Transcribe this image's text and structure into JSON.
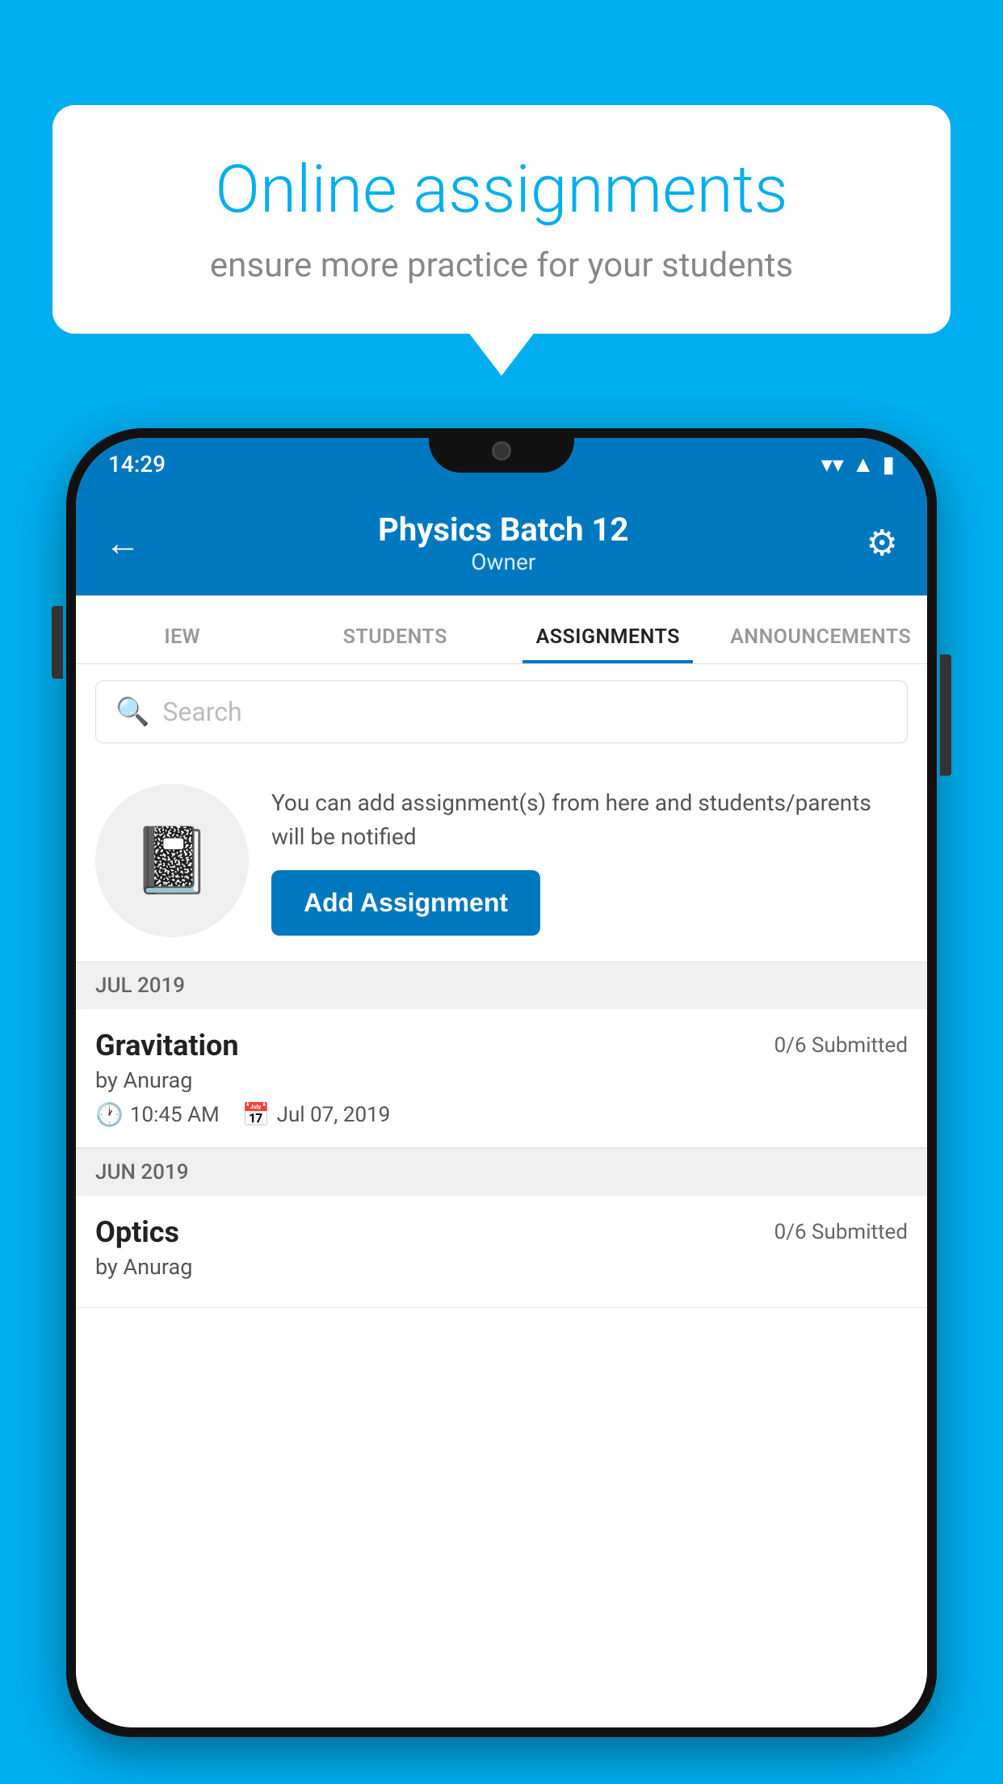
{
  "background_color": "#00AEEF",
  "speech_bubble": {
    "title": "Online assignments",
    "subtitle": "ensure more practice for your students"
  },
  "status_bar": {
    "time": "14:29",
    "icons": [
      "wifi",
      "signal",
      "battery"
    ]
  },
  "header": {
    "title": "Physics Batch 12",
    "subtitle": "Owner",
    "back_label": "←",
    "settings_label": "⚙"
  },
  "tabs": [
    {
      "id": "iew",
      "label": "IEW",
      "active": false
    },
    {
      "id": "students",
      "label": "STUDENTS",
      "active": false
    },
    {
      "id": "assignments",
      "label": "ASSIGNMENTS",
      "active": true
    },
    {
      "id": "announcements",
      "label": "ANNOUNCEMENTS",
      "active": false
    }
  ],
  "search": {
    "placeholder": "Search"
  },
  "promo": {
    "description": "You can add assignment(s) from here and students/parents will be notified",
    "button_label": "Add Assignment"
  },
  "sections": [
    {
      "label": "JUL 2019",
      "assignments": [
        {
          "name": "Gravitation",
          "submitted": "0/6 Submitted",
          "by": "by Anurag",
          "time": "10:45 AM",
          "date": "Jul 07, 2019"
        }
      ]
    },
    {
      "label": "JUN 2019",
      "assignments": [
        {
          "name": "Optics",
          "submitted": "0/6 Submitted",
          "by": "by Anurag",
          "time": "",
          "date": ""
        }
      ]
    }
  ]
}
